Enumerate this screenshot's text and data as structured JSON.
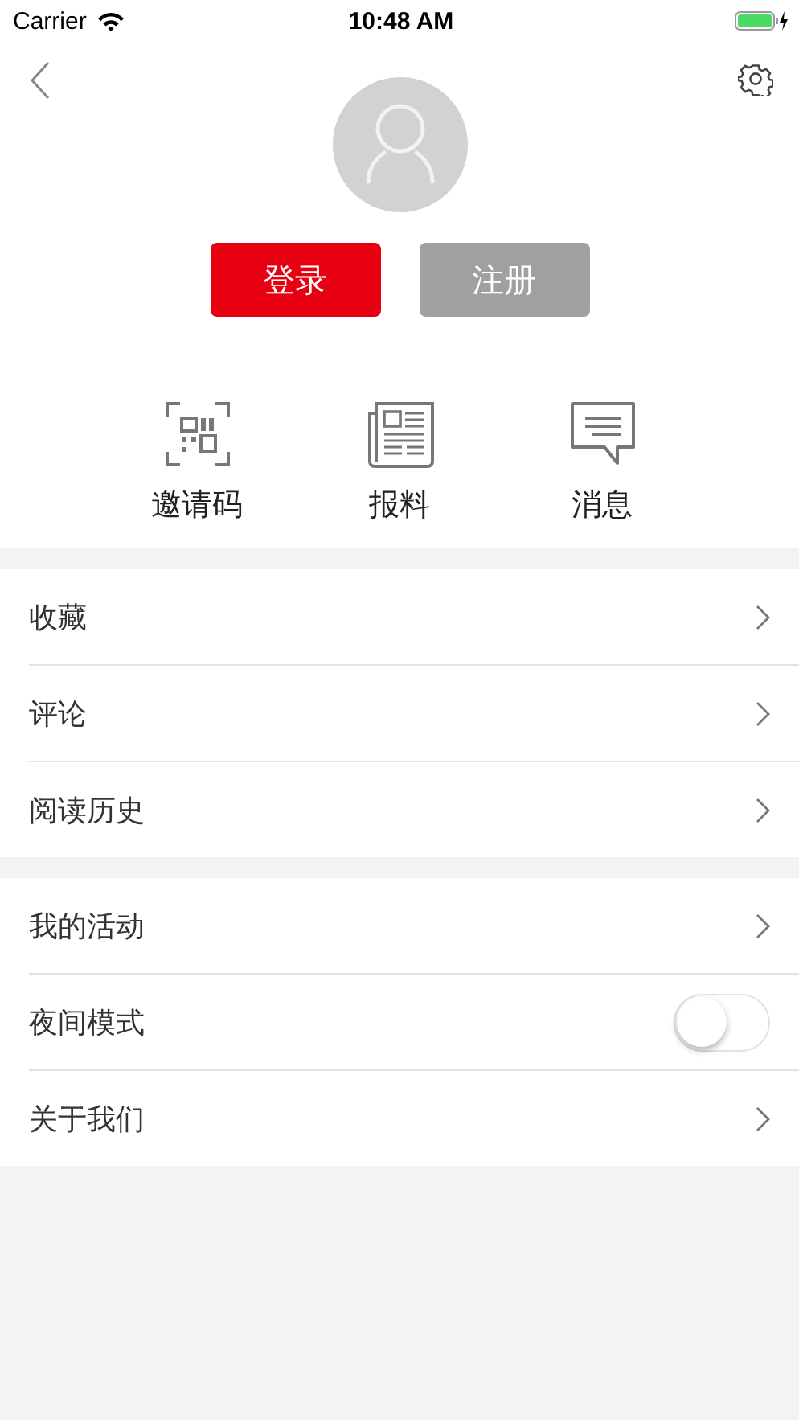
{
  "status_bar": {
    "carrier": "Carrier",
    "time": "10:48 AM"
  },
  "auth_buttons": [
    {
      "label": "登录",
      "kind": "primary"
    },
    {
      "label": "注册",
      "kind": "secondary"
    }
  ],
  "shortcuts": [
    {
      "label": "邀请码",
      "kind": "qr"
    },
    {
      "label": "报料",
      "kind": "news"
    },
    {
      "label": "消息",
      "kind": "message"
    }
  ],
  "groups": [
    [
      {
        "label": "收藏",
        "kind": "link"
      },
      {
        "label": "评论",
        "kind": "link"
      },
      {
        "label": "阅读历史",
        "kind": "link"
      }
    ],
    [
      {
        "label": "我的活动",
        "kind": "link"
      },
      {
        "label": "夜间模式",
        "kind": "toggle",
        "on": false
      },
      {
        "label": "关于我们",
        "kind": "link"
      }
    ]
  ]
}
